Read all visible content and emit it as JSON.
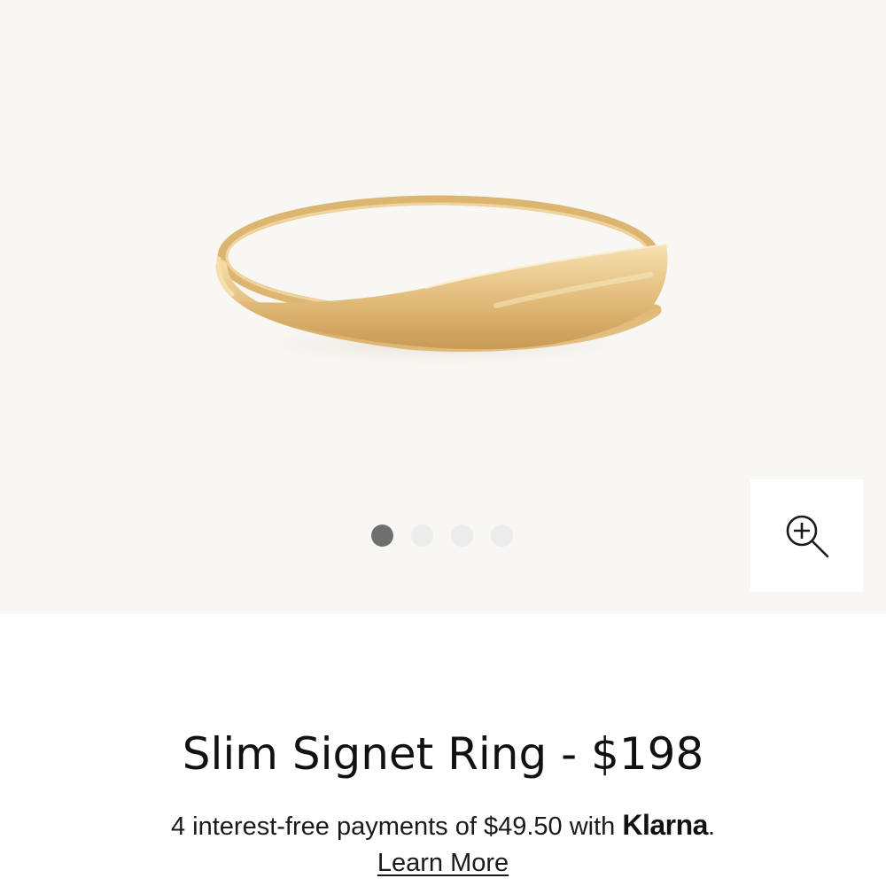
{
  "product": {
    "title": "Slim Signet Ring - $198",
    "image_alt": "Slim Signet Ring in gold"
  },
  "gallery": {
    "slide_count": 4,
    "active_slide": 1
  },
  "payments": {
    "prefix": "4 interest-free payments of $49.50 with ",
    "provider": "Klarna",
    "suffix": ".",
    "learn_more_label": "Learn More"
  },
  "icons": {
    "zoom": "zoom-in-icon"
  },
  "colors": {
    "gallery_background": "#f9f7f3",
    "dot_active": "#6f6f6f",
    "dot_inactive": "#ececec",
    "gold_light": "#f2d59a",
    "gold_mid": "#d9b06a",
    "gold_dark": "#b98a45"
  }
}
